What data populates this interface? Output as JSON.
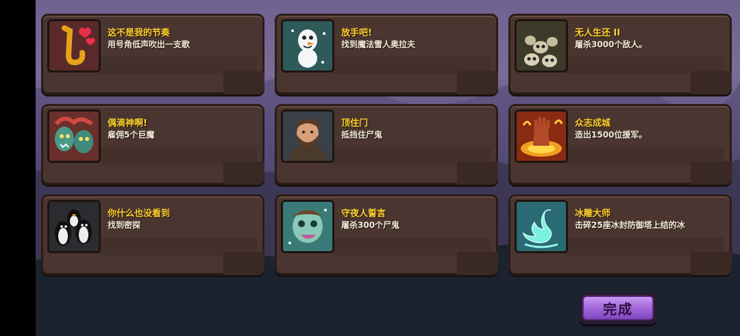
{
  "achievements": [
    {
      "title": "这不是我的节奏",
      "desc": "用号角低声吹出一支歌",
      "icon": "saxophone-hearts-icon"
    },
    {
      "title": "放手吧!",
      "desc": "找到魔法雪人奥拉夫",
      "icon": "snowman-icon"
    },
    {
      "title": "无人生还 II",
      "desc": "屠杀3000个敌人。",
      "icon": "skull-pile-icon"
    },
    {
      "title": "偶滴神啊!",
      "desc": "雇佣5个巨魔",
      "icon": "trolls-icon"
    },
    {
      "title": "顶住门",
      "desc": "抵挡住尸鬼",
      "icon": "bearded-warrior-icon"
    },
    {
      "title": "众志成城",
      "desc": "造出1500位援军。",
      "icon": "fire-fist-icon"
    },
    {
      "title": "你什么也没看到",
      "desc": "找到密探",
      "icon": "penguins-icon"
    },
    {
      "title": "守夜人誓言",
      "desc": "屠杀300个尸鬼",
      "icon": "ghoul-icon"
    },
    {
      "title": "冰雕大师",
      "desc": "击碎25座冰封防御塔上结的冰",
      "icon": "ice-swan-icon"
    }
  ],
  "done_button": {
    "label": "完成"
  },
  "colors": {
    "title": "#ffd22e",
    "card": "#4a3530",
    "button": "#9f62d8"
  }
}
